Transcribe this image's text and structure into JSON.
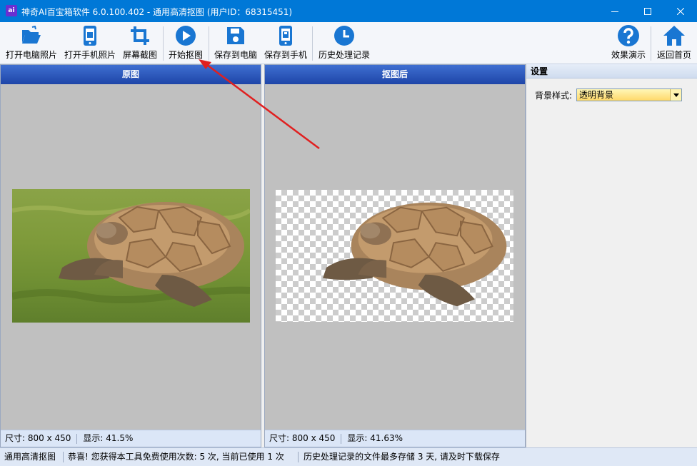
{
  "window": {
    "title": "神奇AI百宝箱软件 6.0.100.402 - 通用高清抠图 (用户ID：68315451)",
    "app_icon_text": "ai"
  },
  "toolbar": {
    "open_pc_photo": "打开电脑照片",
    "open_phone_photo": "打开手机照片",
    "screenshot": "屏幕截图",
    "start_cutout": "开始抠图",
    "save_to_pc": "保存到电脑",
    "save_to_phone": "保存到手机",
    "history": "历史处理记录",
    "demo": "效果演示",
    "home": "返回首页"
  },
  "left_panel": {
    "header": "原图",
    "size_text": "尺寸: 800 x 450",
    "zoom_text": "显示: 41.5%"
  },
  "right_panel": {
    "header": "抠图后",
    "size_text": "尺寸: 800 x 450",
    "zoom_text": "显示: 41.63%"
  },
  "settings": {
    "header": "设置",
    "background_label": "背景样式:",
    "background_value": "透明背景"
  },
  "statusbar": {
    "mode": "通用高清抠图",
    "message": "恭喜! 您获得本工具免费使用次数: 5 次, 当前已使用 1 次",
    "note": "历史处理记录的文件最多存储 3 天, 请及时下载保存"
  },
  "colors": {
    "titlebar": "#0078d7",
    "toolbar_icon": "#1976d2",
    "panel_header": "#2a55b8",
    "annotation_arrow": "#e02020",
    "combo_fill": "#ffe27a"
  },
  "icons": [
    "folder-open-icon",
    "phone-icon",
    "crop-icon",
    "play-icon",
    "save-disk-icon",
    "phone-save-icon",
    "clock-icon",
    "help-icon",
    "home-icon"
  ]
}
